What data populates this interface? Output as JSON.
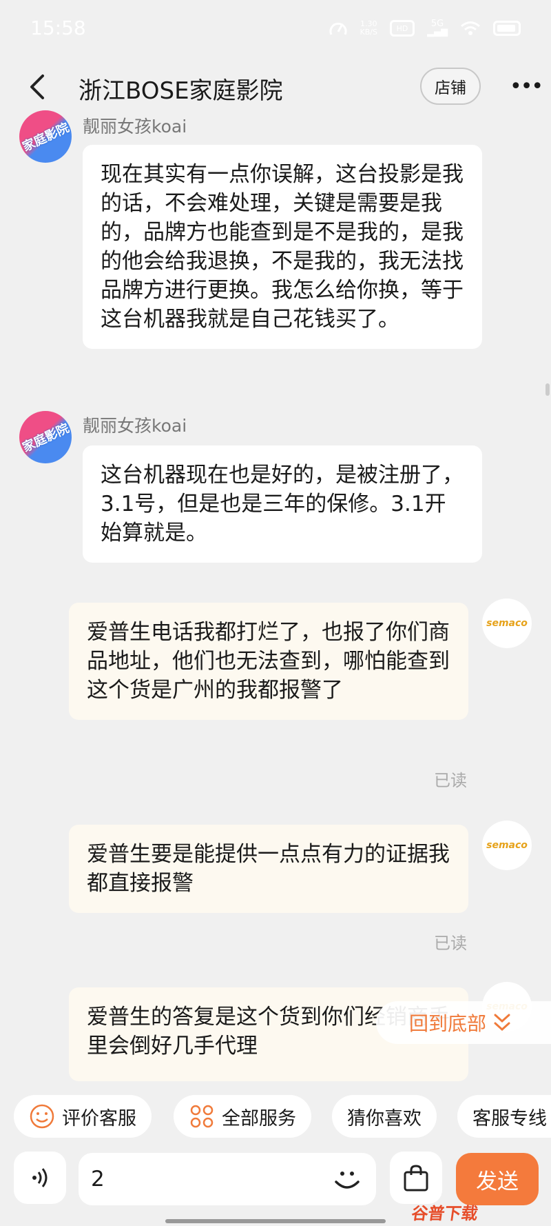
{
  "status_bar": {
    "time": "15:58",
    "net_speed": "1.30\nKB/S",
    "hd": "HD",
    "signal": "5G",
    "wifi": "wifi-icon",
    "battery": "battery-icon"
  },
  "header": {
    "title": "浙江BOSE家庭影院",
    "shop_label": "店铺",
    "more_icon": "more-icon"
  },
  "messages": [
    {
      "side": "left",
      "sender": "靓丽女孩koai",
      "avatar_text": "家庭影院",
      "text": "现在其实有一点你误解，这台投影是我的话，不会难处理，关键是需要是我的，品牌方也能查到是不是我的，是我的他会给我退换，不是我的，我无法找品牌方进行更换。我怎么给你换，等于这台机器我就是自己花钱买了。"
    },
    {
      "side": "left",
      "sender": "靓丽女孩koai",
      "avatar_text": "家庭影院",
      "text": "这台机器现在也是好的，是被注册了，3.1号，但是也是三年的保修。3.1开始算就是。"
    },
    {
      "side": "right",
      "avatar_text": "semaco",
      "text": "爱普生电话我都打烂了，也报了你们商品地址，他们也无法查到，哪怕能查到这个货是广州的我都报警了",
      "status": "已读"
    },
    {
      "side": "right",
      "avatar_text": "semaco",
      "text": "爱普生要是能提供一点点有力的证据我都直接报警",
      "status": "已读"
    },
    {
      "side": "right",
      "avatar_text": "semaco",
      "text": "爱普生的答复是这个货到你们经销商手里会倒好几手代理"
    }
  ],
  "back_to_bottom": "回到底部",
  "quick_actions": [
    {
      "label": "评价客服",
      "icon": "smile-icon"
    },
    {
      "label": "全部服务",
      "icon": "grid-icon"
    },
    {
      "label": "猜你喜欢",
      "icon": ""
    },
    {
      "label": "客服专线",
      "icon": ""
    }
  ],
  "input": {
    "value": "2",
    "send_label": "发送"
  },
  "watermark": "谷普下载",
  "colors": {
    "accent": "#f47a3c",
    "bubble_self": "#fdf9f0",
    "background": "#f0f0f0"
  }
}
